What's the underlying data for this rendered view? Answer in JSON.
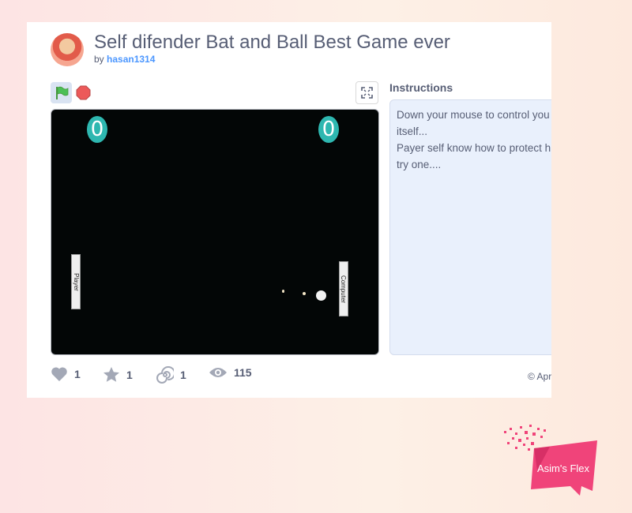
{
  "project": {
    "title": "Self difender Bat and Ball Best Game ever",
    "by_label": "by",
    "author": "hasan1314"
  },
  "controls": {
    "flag_icon": "green-flag-icon",
    "stop_icon": "stop-sign-icon",
    "fullscreen_icon": "fullscreen-icon"
  },
  "stage": {
    "score_left": "0",
    "score_right": "0",
    "player_label": "Player",
    "computer_label": "Computer"
  },
  "instructions": {
    "heading": "Instructions",
    "lines": [
      "Down your mouse to control you",
      "itself...",
      "Payer self know how to protect h",
      "try one...."
    ]
  },
  "stats": {
    "loves": "1",
    "favorites": "1",
    "remixes": "1",
    "views": "115"
  },
  "date_note": "© Apr",
  "watermark": "Asim's Flex",
  "colors": {
    "flag_green": "#4cbf56",
    "stop_red": "#ec5959",
    "score_teal": "#2eb7b0",
    "logo_pink": "#f0447a",
    "author_link": "#4c97ff"
  }
}
